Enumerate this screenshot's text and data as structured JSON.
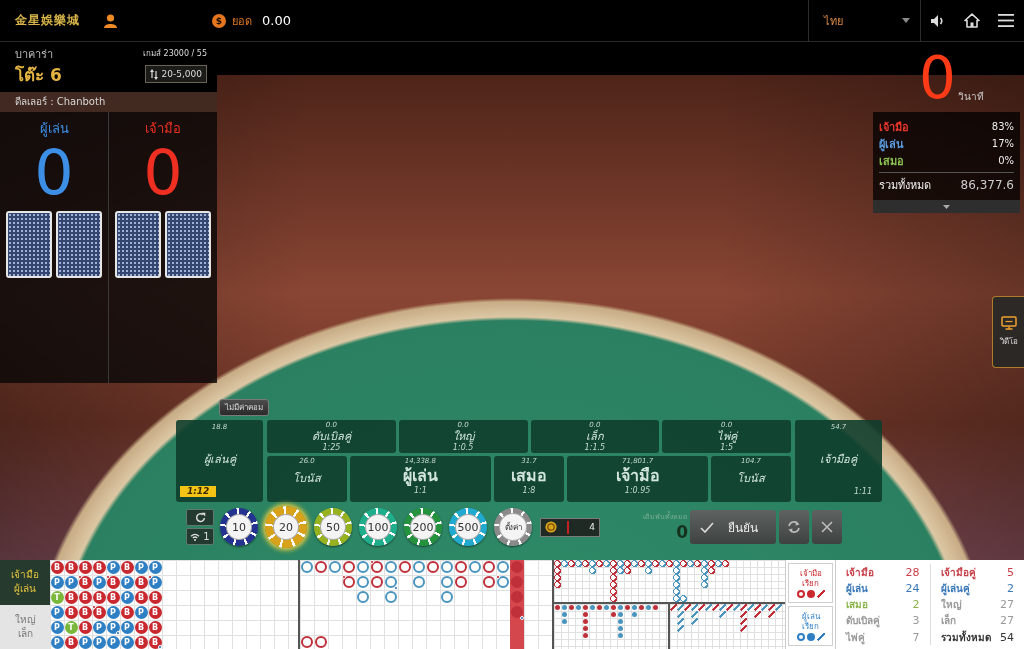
{
  "top_bar": {
    "logo_text": "金星娛樂城",
    "balance": {
      "symbol": "$",
      "label": "ยอด",
      "value": "0.00"
    },
    "language": "ไทย"
  },
  "table_info": {
    "game_type": "บาคาร่า",
    "table_name": "โต๊ะ 6",
    "round": "เกมส์ 23000 / 55",
    "bet_limit": "20-5,000",
    "dealer": "ดีลเลอร์ : Chanboth"
  },
  "scoreboard": [
    {
      "label": "ผู้เล่น",
      "score": "0",
      "color": "#3d8fe6",
      "cards": [
        {
          "face_down": true
        },
        {
          "face_down": true
        }
      ]
    },
    {
      "label": "เจ้ามือ",
      "score": "0",
      "color": "#ee2f22",
      "cards": [
        {
          "face_down": true
        },
        {
          "face_down": true
        }
      ]
    }
  ],
  "countdown": {
    "value": "0",
    "unit": "วินาที"
  },
  "bet_stats": {
    "rows": [
      {
        "label": "เจ้ามือ",
        "value": "83%",
        "color": "#e8362c"
      },
      {
        "label": "ผู้เล่น",
        "value": "17%",
        "color": "#5b9be0"
      },
      {
        "label": "เสมอ",
        "value": "0%",
        "color": "#8cc152"
      }
    ],
    "total": {
      "label": "รวมทั้งหมด",
      "value": "86,377.6"
    }
  },
  "side_tab": {
    "label": "วิดีโอ"
  },
  "commission_button": "ไม่มีค่าคอม",
  "bet_areas": {
    "player_pair": {
      "amount": "18.8",
      "label": "ผู้เล่นคู่",
      "odds": "1:12",
      "odds_badge": true
    },
    "top_row": [
      {
        "amount": "0.0",
        "label": "ดับเบิลคู่",
        "odds": "1:25"
      },
      {
        "amount": "0.0",
        "label": "ใหญ่",
        "odds": "1:0.5"
      },
      {
        "amount": "0.0",
        "label": "เล็ก",
        "odds": "1:1.5"
      },
      {
        "amount": "0.0",
        "label": "ไพ่คู่",
        "odds": "1:5"
      }
    ],
    "bottom_row": [
      {
        "kind": "side",
        "amount": "26.0",
        "label": "โบนัส"
      },
      {
        "kind": "main",
        "amount": "14,338.8",
        "label": "ผู้เล่น",
        "odds": "1:1"
      },
      {
        "kind": "main",
        "amount": "31.7",
        "label": "เสมอ",
        "odds": "1:8"
      },
      {
        "kind": "main",
        "amount": "71,801.7",
        "label": "เจ้ามือ",
        "odds": "1:0.95"
      },
      {
        "kind": "side",
        "amount": "104.7",
        "label": "โบนัส"
      }
    ],
    "banker_pair": {
      "amount": "54.7",
      "label": "เจ้ามือคู่",
      "odds": "1:11",
      "odds_badge": false
    }
  },
  "chips": [
    {
      "kind": "value",
      "label": "10",
      "color": "#23338f",
      "selected": false
    },
    {
      "kind": "value",
      "label": "20",
      "color": "#d9a21b",
      "selected": true
    },
    {
      "kind": "value",
      "label": "50",
      "color": "#97b21f",
      "selected": false
    },
    {
      "kind": "value",
      "label": "100",
      "color": "#1fae8c",
      "selected": false
    },
    {
      "kind": "value",
      "label": "200",
      "color": "#25923e",
      "selected": false
    },
    {
      "kind": "value",
      "label": "500",
      "color": "#22a9cf",
      "selected": false
    },
    {
      "kind": "custom",
      "label": "ตั้งค่า",
      "color": "#8a8a8a",
      "selected": false
    }
  ],
  "connection": {
    "count": "1"
  },
  "counter": {
    "value": "4"
  },
  "total_bet": {
    "label": "เดิมพันทั้งหมด",
    "value": "0"
  },
  "buttons": {
    "confirm": "ยืนยัน"
  },
  "roadmap": {
    "toggles": [
      {
        "lines": [
          "เจ้ามือ",
          "ผู้เล่น"
        ],
        "selected": true
      },
      {
        "lines": [
          "ใหญ่",
          "เล็ก"
        ],
        "selected": false
      }
    ],
    "bead_road": [
      [
        {
          "text": "B",
          "color": "#c8282e",
          "banker_pair": false,
          "player_pair": false
        },
        {
          "text": "B",
          "color": "#c8282e",
          "banker_pair": false,
          "player_pair": false
        },
        {
          "text": "B",
          "color": "#c8282e",
          "banker_pair": false,
          "player_pair": false
        },
        {
          "text": "B",
          "color": "#c8282e",
          "banker_pair": false,
          "player_pair": false
        },
        {
          "text": "P",
          "color": "#2f7fc4",
          "banker_pair": false,
          "player_pair": false
        },
        {
          "text": "B",
          "color": "#c8282e",
          "banker_pair": false,
          "player_pair": false
        },
        {
          "text": "P",
          "color": "#2f7fc4",
          "banker_pair": false,
          "player_pair": false
        },
        {
          "text": "P",
          "color": "#2f7fc4",
          "banker_pair": false,
          "player_pair": false
        }
      ],
      [
        {
          "text": "P",
          "color": "#2f7fc4",
          "banker_pair": false,
          "player_pair": false
        },
        {
          "text": "P",
          "color": "#2f7fc4",
          "banker_pair": false,
          "player_pair": false
        },
        {
          "text": "B",
          "color": "#c8282e",
          "banker_pair": true,
          "player_pair": false
        },
        {
          "text": "P",
          "color": "#2f7fc4",
          "banker_pair": false,
          "player_pair": false
        },
        {
          "text": "B",
          "color": "#c8282e",
          "banker_pair": true,
          "player_pair": false
        },
        {
          "text": "P",
          "color": "#2f7fc4",
          "banker_pair": false,
          "player_pair": false
        },
        {
          "text": "B",
          "color": "#c8282e",
          "banker_pair": false,
          "player_pair": false
        },
        {
          "text": "P",
          "color": "#2f7fc4",
          "banker_pair": true,
          "player_pair": false
        }
      ],
      [
        {
          "text": "T",
          "color": "#79b83a",
          "banker_pair": false,
          "player_pair": false
        },
        {
          "text": "B",
          "color": "#c8282e",
          "banker_pair": false,
          "player_pair": false
        },
        {
          "text": "B",
          "color": "#c8282e",
          "banker_pair": false,
          "player_pair": false
        },
        {
          "text": "B",
          "color": "#c8282e",
          "banker_pair": false,
          "player_pair": false
        },
        {
          "text": "B",
          "color": "#c8282e",
          "banker_pair": false,
          "player_pair": false
        },
        {
          "text": "P",
          "color": "#2f7fc4",
          "banker_pair": false,
          "player_pair": false
        },
        {
          "text": "B",
          "color": "#c8282e",
          "banker_pair": false,
          "player_pair": false
        },
        {
          "text": "B",
          "color": "#c8282e",
          "banker_pair": false,
          "player_pair": false
        }
      ],
      [
        {
          "text": "P",
          "color": "#2f7fc4",
          "banker_pair": false,
          "player_pair": false
        },
        {
          "text": "B",
          "color": "#c8282e",
          "banker_pair": false,
          "player_pair": false
        },
        {
          "text": "B",
          "color": "#c8282e",
          "banker_pair": false,
          "player_pair": false
        },
        {
          "text": "B",
          "color": "#c8282e",
          "banker_pair": true,
          "player_pair": false
        },
        {
          "text": "P",
          "color": "#2f7fc4",
          "banker_pair": false,
          "player_pair": false
        },
        {
          "text": "B",
          "color": "#c8282e",
          "banker_pair": false,
          "player_pair": false
        },
        {
          "text": "P",
          "color": "#2f7fc4",
          "banker_pair": false,
          "player_pair": false
        },
        {
          "text": "B",
          "color": "#c8282e",
          "banker_pair": false,
          "player_pair": false
        }
      ],
      [
        {
          "text": "P",
          "color": "#2f7fc4",
          "banker_pair": false,
          "player_pair": false
        },
        {
          "text": "T",
          "color": "#79b83a",
          "banker_pair": false,
          "player_pair": false
        },
        {
          "text": "B",
          "color": "#c8282e",
          "banker_pair": false,
          "player_pair": false
        },
        {
          "text": "P",
          "color": "#2f7fc4",
          "banker_pair": false,
          "player_pair": false
        },
        {
          "text": "P",
          "color": "#2f7fc4",
          "banker_pair": false,
          "player_pair": true
        },
        {
          "text": "P",
          "color": "#2f7fc4",
          "banker_pair": false,
          "player_pair": false
        },
        {
          "text": "B",
          "color": "#c8282e",
          "banker_pair": false,
          "player_pair": false
        },
        {
          "text": "B",
          "color": "#c8282e",
          "banker_pair": false,
          "player_pair": false
        }
      ],
      [
        {
          "text": "P",
          "color": "#2f7fc4",
          "banker_pair": false,
          "player_pair": false
        },
        {
          "text": "B",
          "color": "#c8282e",
          "banker_pair": false,
          "player_pair": false
        },
        {
          "text": "P",
          "color": "#2f7fc4",
          "banker_pair": false,
          "player_pair": false
        },
        {
          "text": "P",
          "color": "#2f7fc4",
          "banker_pair": false,
          "player_pair": false
        },
        {
          "text": "P",
          "color": "#2f7fc4",
          "banker_pair": false,
          "player_pair": false
        },
        {
          "text": "P",
          "color": "#2f7fc4",
          "banker_pair": false,
          "player_pair": false
        },
        {
          "text": "B",
          "color": "#c8282e",
          "banker_pair": false,
          "player_pair": false
        },
        {
          "text": "B",
          "color": "#c8282e",
          "banker_pair": false,
          "player_pair": true
        }
      ]
    ],
    "big_road": [
      {
        "highlighted": false,
        "cells": [
          {
            "marked": true,
            "color": "#4a95c0",
            "banker_pair": false,
            "player_pair": false
          },
          {
            "marked": false,
            "banker_pair": false,
            "player_pair": false
          },
          {
            "marked": false,
            "banker_pair": false,
            "player_pair": false
          },
          {
            "marked": false,
            "banker_pair": false,
            "player_pair": false
          },
          {
            "marked": false,
            "banker_pair": false,
            "player_pair": false
          },
          {
            "marked": true,
            "color": "#c0303a",
            "banker_pair": false,
            "player_pair": false
          }
        ]
      },
      {
        "highlighted": false,
        "cells": [
          {
            "marked": true,
            "color": "#c0303a",
            "banker_pair": false,
            "player_pair": false
          },
          {
            "marked": false,
            "banker_pair": false,
            "player_pair": false
          },
          {
            "marked": false,
            "banker_pair": false,
            "player_pair": false
          },
          {
            "marked": false,
            "banker_pair": false,
            "player_pair": false
          },
          {
            "marked": false,
            "banker_pair": false,
            "player_pair": false
          },
          {
            "marked": true,
            "color": "#c0303a",
            "banker_pair": false,
            "player_pair": false
          }
        ]
      },
      {
        "highlighted": false,
        "cells": [
          {
            "marked": true,
            "color": "#4a95c0",
            "banker_pair": false,
            "player_pair": false
          }
        ]
      },
      {
        "highlighted": false,
        "cells": [
          {
            "marked": true,
            "color": "#c0303a",
            "banker_pair": false,
            "player_pair": false
          },
          {
            "marked": true,
            "color": "#c0303a",
            "banker_pair": true,
            "player_pair": false
          }
        ]
      },
      {
        "highlighted": false,
        "cells": [
          {
            "marked": true,
            "color": "#4a95c0",
            "banker_pair": false,
            "player_pair": false
          },
          {
            "marked": true,
            "color": "#4a95c0",
            "banker_pair": false,
            "player_pair": false
          },
          {
            "marked": true,
            "color": "#4a95c0",
            "banker_pair": false,
            "player_pair": false
          }
        ]
      },
      {
        "highlighted": false,
        "cells": [
          {
            "marked": true,
            "color": "#c0303a",
            "banker_pair": true,
            "player_pair": false
          },
          {
            "marked": true,
            "color": "#c0303a",
            "banker_pair": false,
            "player_pair": false
          }
        ]
      },
      {
        "highlighted": false,
        "cells": [
          {
            "marked": true,
            "color": "#4a95c0",
            "banker_pair": false,
            "player_pair": false
          },
          {
            "marked": true,
            "color": "#4a95c0",
            "banker_pair": false,
            "player_pair": true
          },
          {
            "marked": true,
            "color": "#4a95c0",
            "banker_pair": false,
            "player_pair": false
          }
        ]
      },
      {
        "highlighted": false,
        "cells": [
          {
            "marked": true,
            "color": "#c0303a",
            "banker_pair": false,
            "player_pair": false
          }
        ]
      },
      {
        "highlighted": false,
        "cells": [
          {
            "marked": true,
            "color": "#4a95c0",
            "banker_pair": false,
            "player_pair": false
          },
          {
            "marked": true,
            "color": "#4a95c0",
            "banker_pair": false,
            "player_pair": false
          }
        ]
      },
      {
        "highlighted": false,
        "cells": [
          {
            "marked": true,
            "color": "#c0303a",
            "banker_pair": false,
            "player_pair": false
          }
        ]
      },
      {
        "highlighted": false,
        "cells": [
          {
            "marked": true,
            "color": "#4a95c0",
            "banker_pair": false,
            "player_pair": false
          },
          {
            "marked": true,
            "color": "#4a95c0",
            "banker_pair": false,
            "player_pair": false
          },
          {
            "marked": true,
            "color": "#4a95c0",
            "banker_pair": false,
            "player_pair": false
          }
        ]
      },
      {
        "highlighted": false,
        "cells": [
          {
            "marked": true,
            "color": "#c0303a",
            "banker_pair": false,
            "player_pair": false
          },
          {
            "marked": true,
            "color": "#c0303a",
            "banker_pair": false,
            "player_pair": false
          }
        ]
      },
      {
        "highlighted": false,
        "cells": [
          {
            "marked": true,
            "color": "#4a95c0",
            "banker_pair": false,
            "player_pair": false
          }
        ]
      },
      {
        "highlighted": false,
        "cells": [
          {
            "marked": true,
            "color": "#c0303a",
            "banker_pair": false,
            "player_pair": false
          },
          {
            "marked": true,
            "color": "#c0303a",
            "banker_pair": false,
            "player_pair": false
          }
        ]
      },
      {
        "highlighted": false,
        "cells": [
          {
            "marked": true,
            "color": "#4a95c0",
            "banker_pair": false,
            "player_pair": false
          },
          {
            "marked": true,
            "color": "#4a95c0",
            "banker_pair": true,
            "player_pair": false
          }
        ]
      },
      {
        "highlighted": true,
        "cells": [
          {
            "marked": true,
            "color": "#c0303a",
            "banker_pair": false,
            "player_pair": false
          },
          {
            "marked": true,
            "color": "#c0303a",
            "banker_pair": false,
            "player_pair": false
          },
          {
            "marked": true,
            "color": "#c0303a",
            "banker_pair": false,
            "player_pair": false
          },
          {
            "marked": true,
            "color": "#c0303a",
            "banker_pair": false,
            "player_pair": true
          }
        ]
      }
    ],
    "big_eye_road": [
      [
        {
          "marked": true,
          "color": "#c0303a"
        },
        {
          "marked": true,
          "color": "#c0303a"
        },
        {
          "marked": true,
          "color": "#c0303a"
        },
        {
          "marked": true,
          "color": "#c0303a"
        }
      ],
      [
        {
          "marked": true,
          "color": "#4a95c0"
        }
      ],
      [
        {
          "marked": true,
          "color": "#c0303a"
        }
      ],
      [
        {
          "marked": true,
          "color": "#4a95c0"
        }
      ],
      [
        {
          "marked": true,
          "color": "#c0303a"
        }
      ],
      [
        {
          "marked": true,
          "color": "#4a95c0"
        },
        {
          "marked": true,
          "color": "#4a95c0"
        }
      ],
      [
        {
          "marked": true,
          "color": "#c0303a"
        }
      ],
      [
        {
          "marked": true,
          "color": "#4a95c0"
        }
      ],
      [
        {
          "marked": true,
          "color": "#c0303a"
        },
        {
          "marked": true,
          "color": "#c0303a"
        },
        {
          "marked": true,
          "color": "#c0303a"
        },
        {
          "marked": true,
          "color": "#c0303a"
        },
        {
          "marked": true,
          "color": "#c0303a"
        },
        {
          "marked": true,
          "color": "#c0303a"
        }
      ],
      [
        {
          "marked": true,
          "color": "#4a95c0"
        },
        {
          "marked": true,
          "color": "#4a95c0"
        }
      ],
      [
        {
          "marked": true,
          "color": "#c0303a"
        },
        {
          "marked": true,
          "color": "#c0303a"
        }
      ],
      [
        {
          "marked": true,
          "color": "#4a95c0"
        }
      ],
      [
        {
          "marked": true,
          "color": "#c0303a"
        }
      ],
      [
        {
          "marked": true,
          "color": "#4a95c0"
        },
        {
          "marked": true,
          "color": "#4a95c0"
        }
      ],
      [
        {
          "marked": true,
          "color": "#c0303a"
        }
      ],
      [
        {
          "marked": true,
          "color": "#4a95c0"
        }
      ],
      [
        {
          "marked": true,
          "color": "#c0303a"
        }
      ],
      [
        {
          "marked": true,
          "color": "#4a95c0"
        },
        {
          "marked": true,
          "color": "#4a95c0"
        },
        {
          "marked": true,
          "color": "#4a95c0"
        },
        {
          "marked": true,
          "color": "#4a95c0"
        },
        {
          "marked": true,
          "color": "#4a95c0"
        },
        {
          "marked": true,
          "color": "#4a95c0"
        }
      ],
      [
        {
          "marked": true,
          "color": "#c0303a"
        },
        {
          "marked": false
        },
        {
          "marked": false
        },
        {
          "marked": false
        },
        {
          "marked": false
        },
        {
          "marked": true,
          "color": "#4a95c0"
        }
      ],
      [
        {
          "marked": true,
          "color": "#4a95c0"
        }
      ],
      [
        {
          "marked": true,
          "color": "#c0303a"
        }
      ],
      [
        {
          "marked": true,
          "color": "#4a95c0"
        },
        {
          "marked": true,
          "color": "#4a95c0"
        },
        {
          "marked": true,
          "color": "#4a95c0"
        },
        {
          "marked": true,
          "color": "#4a95c0"
        }
      ],
      [
        {
          "marked": true,
          "color": "#c0303a"
        },
        {
          "marked": true,
          "color": "#c0303a"
        }
      ],
      [
        {
          "marked": true,
          "color": "#4a95c0"
        }
      ],
      [
        {
          "marked": true,
          "color": "#c0303a"
        }
      ]
    ],
    "small_road": [
      [
        {
          "color": "#c0303a"
        }
      ],
      [
        {
          "color": "#4a95c0"
        },
        {
          "color": "#4a95c0"
        },
        {
          "color": "#4a95c0"
        }
      ],
      [
        {
          "color": "#c0303a"
        }
      ],
      [
        {
          "color": "#4a95c0"
        }
      ],
      [
        {
          "color": "#c0303a"
        },
        {
          "color": "#c0303a"
        },
        {
          "color": "#c0303a"
        },
        {
          "color": "#c0303a"
        },
        {
          "color": "#c0303a"
        }
      ],
      [
        {
          "color": "#4a95c0"
        }
      ],
      [
        {
          "color": "#c0303a"
        }
      ],
      [
        {
          "color": "#4a95c0"
        }
      ],
      [
        {
          "color": "#c0303a"
        },
        {
          "color": "#c0303a"
        }
      ],
      [
        {
          "color": "#4a95c0"
        },
        {
          "color": "#4a95c0"
        },
        {
          "color": "#4a95c0"
        },
        {
          "color": "#4a95c0"
        },
        {
          "color": "#4a95c0"
        }
      ],
      [
        {
          "color": "#c0303a"
        }
      ],
      [
        {
          "color": "#4a95c0"
        },
        {
          "color": "#4a95c0"
        }
      ],
      [
        {
          "color": "#c0303a"
        }
      ],
      [
        {
          "color": "#4a95c0"
        }
      ],
      [
        {
          "color": "#c0303a"
        }
      ]
    ],
    "cockroach_road": [
      [
        {
          "color": "#c0303a"
        }
      ],
      [
        {
          "color": "#4a95c0"
        },
        {
          "color": "#4a95c0"
        },
        {
          "color": "#4a95c0"
        },
        {
          "color": "#4a95c0"
        }
      ],
      [
        {
          "color": "#c0303a"
        }
      ],
      [
        {
          "color": "#4a95c0"
        },
        {
          "color": "#4a95c0"
        },
        {
          "color": "#4a95c0"
        }
      ],
      [
        {
          "color": "#c0303a"
        }
      ],
      [
        {
          "color": "#4a95c0"
        }
      ],
      [
        {
          "color": "#c0303a"
        }
      ],
      [
        {
          "color": "#4a95c0"
        },
        {
          "color": "#4a95c0"
        }
      ],
      [
        {
          "color": "#c0303a"
        }
      ],
      [
        {
          "color": "#4a95c0"
        }
      ],
      [
        {
          "color": "#c0303a"
        },
        {
          "color": "#c0303a"
        },
        {
          "color": "#c0303a"
        },
        {
          "color": "#c0303a"
        }
      ],
      [
        {
          "color": "#4a95c0"
        }
      ],
      [
        {
          "color": "#c0303a"
        },
        {
          "color": "#c0303a"
        }
      ],
      [
        {
          "color": "#4a95c0"
        }
      ],
      [
        {
          "color": "#c0303a"
        },
        {
          "color": "#c0303a"
        }
      ],
      [
        {
          "color": "#4a95c0"
        }
      ]
    ],
    "predictions": [
      {
        "label": "เจ้ามือ",
        "action": "เรียก",
        "color": "#c8282e"
      },
      {
        "label": "ผู้เล่น",
        "action": "เรียก",
        "color": "#2f7fc4"
      }
    ],
    "stats": [
      [
        {
          "label": "เจ้ามือ",
          "value": "28",
          "color": "#c8404a"
        },
        {
          "label": "ผู้เล่น",
          "value": "24",
          "color": "#3a78b8"
        },
        {
          "label": "เสมอ",
          "value": "2",
          "color": "#8ab34a"
        },
        {
          "label": "ดับเบิลคู่",
          "value": "3",
          "color": "#9a9a9a"
        },
        {
          "label": "ไพ่คู่",
          "value": "7",
          "color": "#9a9a9a"
        }
      ],
      [
        {
          "label": "เจ้ามือคู่",
          "value": "5",
          "color": "#c8404a"
        },
        {
          "label": "ผู้เล่นคู่",
          "value": "2",
          "color": "#3a78b8"
        },
        {
          "label": "ใหญ่",
          "value": "27",
          "color": "#9a9a9a"
        },
        {
          "label": "เล็ก",
          "value": "27",
          "color": "#9a9a9a"
        },
        {
          "label": "รวมทั้งหมด",
          "value": "54",
          "color": "#333333"
        }
      ]
    ]
  }
}
